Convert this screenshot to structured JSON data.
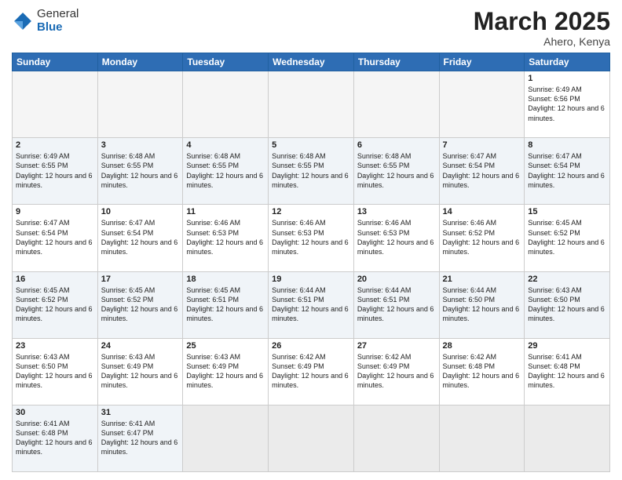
{
  "header": {
    "logo_general": "General",
    "logo_blue": "Blue",
    "title": "March 2025",
    "location": "Ahero, Kenya"
  },
  "days_of_week": [
    "Sunday",
    "Monday",
    "Tuesday",
    "Wednesday",
    "Thursday",
    "Friday",
    "Saturday"
  ],
  "weeks": [
    [
      {
        "day": "",
        "empty": true
      },
      {
        "day": "",
        "empty": true
      },
      {
        "day": "",
        "empty": true
      },
      {
        "day": "",
        "empty": true
      },
      {
        "day": "",
        "empty": true
      },
      {
        "day": "",
        "empty": true
      },
      {
        "day": "1",
        "sunrise": "6:49 AM",
        "sunset": "6:56 PM",
        "daylight": "12 hours and 6 minutes."
      }
    ],
    [
      {
        "day": "2",
        "sunrise": "6:49 AM",
        "sunset": "6:55 PM",
        "daylight": "12 hours and 6 minutes."
      },
      {
        "day": "3",
        "sunrise": "6:48 AM",
        "sunset": "6:55 PM",
        "daylight": "12 hours and 6 minutes."
      },
      {
        "day": "4",
        "sunrise": "6:48 AM",
        "sunset": "6:55 PM",
        "daylight": "12 hours and 6 minutes."
      },
      {
        "day": "5",
        "sunrise": "6:48 AM",
        "sunset": "6:55 PM",
        "daylight": "12 hours and 6 minutes."
      },
      {
        "day": "6",
        "sunrise": "6:48 AM",
        "sunset": "6:55 PM",
        "daylight": "12 hours and 6 minutes."
      },
      {
        "day": "7",
        "sunrise": "6:47 AM",
        "sunset": "6:54 PM",
        "daylight": "12 hours and 6 minutes."
      },
      {
        "day": "8",
        "sunrise": "6:47 AM",
        "sunset": "6:54 PM",
        "daylight": "12 hours and 6 minutes."
      }
    ],
    [
      {
        "day": "9",
        "sunrise": "6:47 AM",
        "sunset": "6:54 PM",
        "daylight": "12 hours and 6 minutes."
      },
      {
        "day": "10",
        "sunrise": "6:47 AM",
        "sunset": "6:54 PM",
        "daylight": "12 hours and 6 minutes."
      },
      {
        "day": "11",
        "sunrise": "6:46 AM",
        "sunset": "6:53 PM",
        "daylight": "12 hours and 6 minutes."
      },
      {
        "day": "12",
        "sunrise": "6:46 AM",
        "sunset": "6:53 PM",
        "daylight": "12 hours and 6 minutes."
      },
      {
        "day": "13",
        "sunrise": "6:46 AM",
        "sunset": "6:53 PM",
        "daylight": "12 hours and 6 minutes."
      },
      {
        "day": "14",
        "sunrise": "6:46 AM",
        "sunset": "6:52 PM",
        "daylight": "12 hours and 6 minutes."
      },
      {
        "day": "15",
        "sunrise": "6:45 AM",
        "sunset": "6:52 PM",
        "daylight": "12 hours and 6 minutes."
      }
    ],
    [
      {
        "day": "16",
        "sunrise": "6:45 AM",
        "sunset": "6:52 PM",
        "daylight": "12 hours and 6 minutes."
      },
      {
        "day": "17",
        "sunrise": "6:45 AM",
        "sunset": "6:52 PM",
        "daylight": "12 hours and 6 minutes."
      },
      {
        "day": "18",
        "sunrise": "6:45 AM",
        "sunset": "6:51 PM",
        "daylight": "12 hours and 6 minutes."
      },
      {
        "day": "19",
        "sunrise": "6:44 AM",
        "sunset": "6:51 PM",
        "daylight": "12 hours and 6 minutes."
      },
      {
        "day": "20",
        "sunrise": "6:44 AM",
        "sunset": "6:51 PM",
        "daylight": "12 hours and 6 minutes."
      },
      {
        "day": "21",
        "sunrise": "6:44 AM",
        "sunset": "6:50 PM",
        "daylight": "12 hours and 6 minutes."
      },
      {
        "day": "22",
        "sunrise": "6:43 AM",
        "sunset": "6:50 PM",
        "daylight": "12 hours and 6 minutes."
      }
    ],
    [
      {
        "day": "23",
        "sunrise": "6:43 AM",
        "sunset": "6:50 PM",
        "daylight": "12 hours and 6 minutes."
      },
      {
        "day": "24",
        "sunrise": "6:43 AM",
        "sunset": "6:49 PM",
        "daylight": "12 hours and 6 minutes."
      },
      {
        "day": "25",
        "sunrise": "6:43 AM",
        "sunset": "6:49 PM",
        "daylight": "12 hours and 6 minutes."
      },
      {
        "day": "26",
        "sunrise": "6:42 AM",
        "sunset": "6:49 PM",
        "daylight": "12 hours and 6 minutes."
      },
      {
        "day": "27",
        "sunrise": "6:42 AM",
        "sunset": "6:49 PM",
        "daylight": "12 hours and 6 minutes."
      },
      {
        "day": "28",
        "sunrise": "6:42 AM",
        "sunset": "6:48 PM",
        "daylight": "12 hours and 6 minutes."
      },
      {
        "day": "29",
        "sunrise": "6:41 AM",
        "sunset": "6:48 PM",
        "daylight": "12 hours and 6 minutes."
      }
    ],
    [
      {
        "day": "30",
        "sunrise": "6:41 AM",
        "sunset": "6:48 PM",
        "daylight": "12 hours and 6 minutes."
      },
      {
        "day": "31",
        "sunrise": "6:41 AM",
        "sunset": "6:47 PM",
        "daylight": "12 hours and 6 minutes."
      },
      {
        "day": "",
        "empty": true
      },
      {
        "day": "",
        "empty": true
      },
      {
        "day": "",
        "empty": true
      },
      {
        "day": "",
        "empty": true
      },
      {
        "day": "",
        "empty": true
      }
    ]
  ]
}
